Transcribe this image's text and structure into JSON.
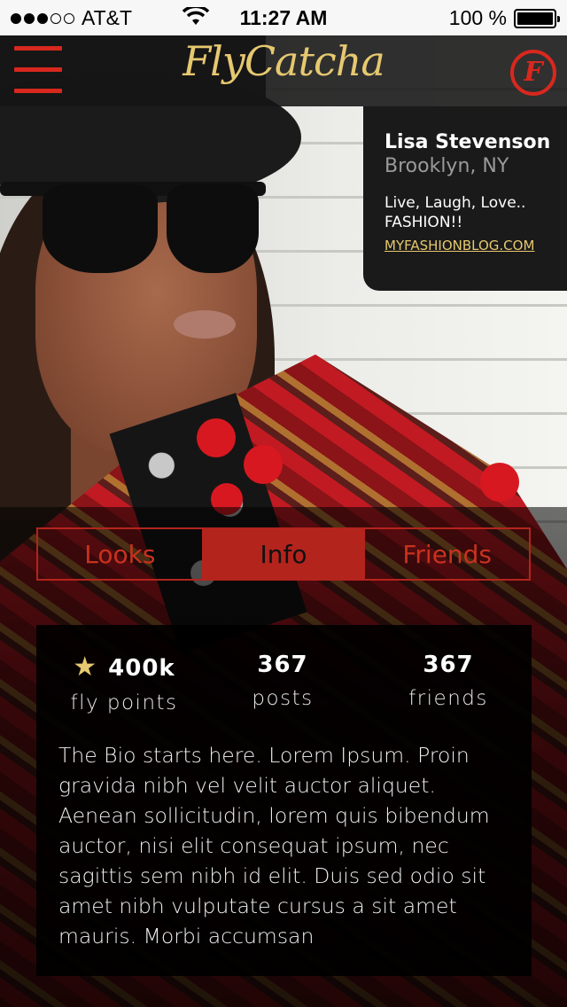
{
  "status_bar": {
    "carrier": "AT&T",
    "time": "11:27 AM",
    "battery": "100 %",
    "signal_bars": 3,
    "signal_total": 5
  },
  "nav": {
    "logo": "FlyCatcha",
    "brand_icon": "F"
  },
  "profile": {
    "name": "Lisa Stevenson",
    "location": "Brooklyn, NY",
    "tagline": "Live, Laugh, Love.. FASHION!!",
    "link": "MYFASHIONBLOG.COM"
  },
  "tabs": [
    {
      "label": "Looks",
      "active": false
    },
    {
      "label": "Info",
      "active": true
    },
    {
      "label": "Friends",
      "active": false
    }
  ],
  "stats": {
    "fly_points": {
      "value": "400k",
      "label": "fly points"
    },
    "posts": {
      "value": "367",
      "label": "posts"
    },
    "friends": {
      "value": "367",
      "label": "friends"
    }
  },
  "bio": "The Bio starts here. Lorem Ipsum. Proin gravida nibh vel velit auctor aliquet. Aenean sollicitudin, lorem quis bibendum auctor, nisi elit consequat ipsum, nec sagittis sem nibh id elit. Duis sed odio sit amet nibh vulputate cursus a sit amet mauris. Morbi accumsan",
  "icons": {
    "menu": "hamburger-icon",
    "brand": "brand-f-icon",
    "star": "star-icon",
    "wifi": "wifi-icon",
    "battery": "battery-icon"
  },
  "colors": {
    "accent_red": "#b3241d",
    "gold": "#e6c870",
    "panel": "#1a1a1a"
  }
}
